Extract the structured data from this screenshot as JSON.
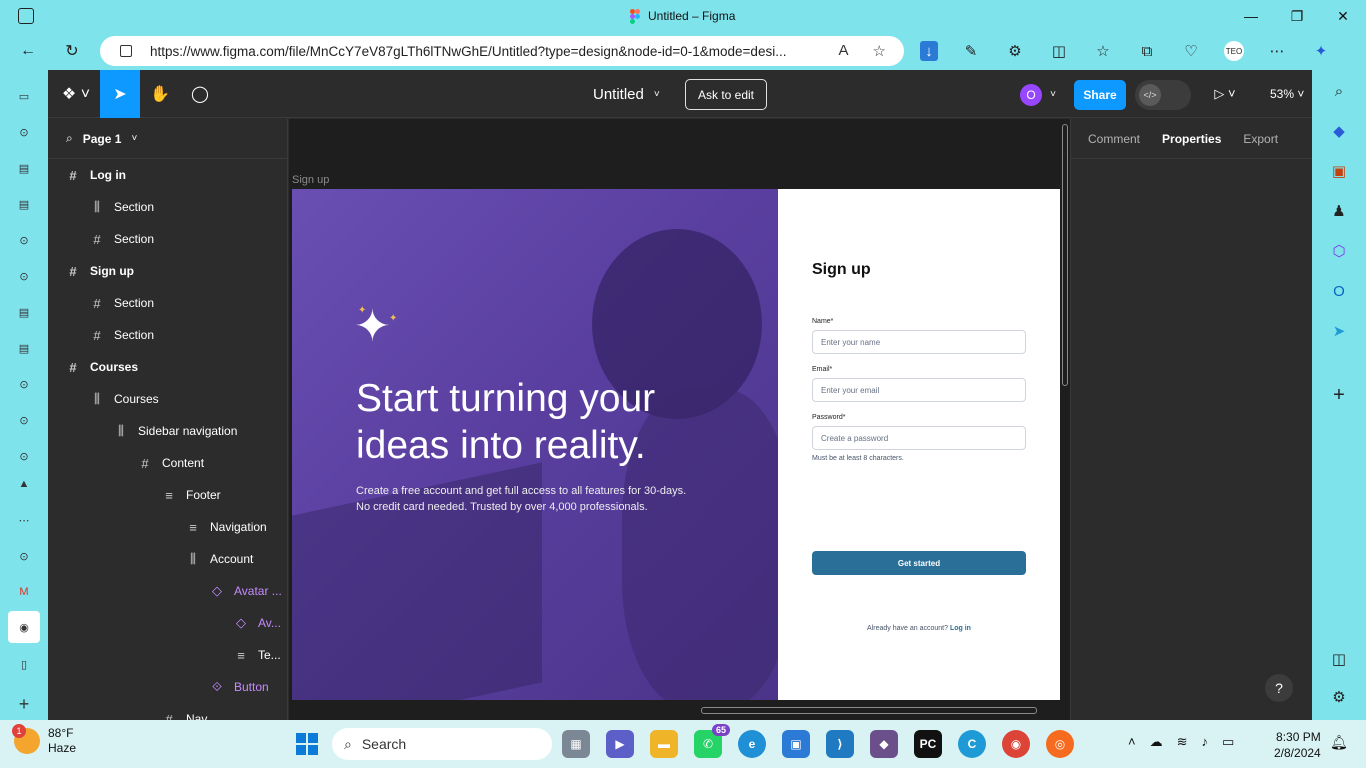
{
  "browser": {
    "window_title": "Untitled – Figma",
    "url": "https://www.figma.com/file/MnCcY7eV87gLTh6lTNwGhE/Untitled?type=design&node-id=0-1&mode=desi...",
    "read_aloud_label": "A",
    "minimize": "—",
    "maximize": "❐",
    "close": "✕"
  },
  "figma": {
    "doc_title": "Untitled",
    "ask_to_edit": "Ask to edit",
    "avatar_initial": "O",
    "share": "Share",
    "zoom": "53%",
    "page_name": "Page 1",
    "layers": [
      {
        "label": "Log in",
        "icon": "frame",
        "indent": 0,
        "bold": true
      },
      {
        "label": "Section",
        "icon": "auto-layout",
        "indent": 1,
        "bold": false
      },
      {
        "label": "Section",
        "icon": "frame",
        "indent": 1,
        "bold": false
      },
      {
        "label": "Sign up",
        "icon": "frame",
        "indent": 0,
        "bold": true
      },
      {
        "label": "Section",
        "icon": "frame",
        "indent": 1,
        "bold": false
      },
      {
        "label": "Section",
        "icon": "frame",
        "indent": 1,
        "bold": false
      },
      {
        "label": "Courses",
        "icon": "frame",
        "indent": 0,
        "bold": true
      },
      {
        "label": "Courses",
        "icon": "auto-layout",
        "indent": 1,
        "bold": false
      },
      {
        "label": "Sidebar navigation",
        "icon": "auto-layout",
        "indent": 2,
        "bold": false
      },
      {
        "label": "Content",
        "icon": "frame",
        "indent": 3,
        "bold": false
      },
      {
        "label": "Footer",
        "icon": "stack",
        "indent": 4,
        "bold": false
      },
      {
        "label": "Navigation",
        "icon": "stack",
        "indent": 5,
        "bold": false
      },
      {
        "label": "Account",
        "icon": "auto-layout",
        "indent": 5,
        "bold": false
      },
      {
        "label": "Avatar ...",
        "icon": "instance",
        "indent": 6,
        "bold": false
      },
      {
        "label": "Av...",
        "icon": "instance",
        "indent": 7,
        "bold": false
      },
      {
        "label": "Te...",
        "icon": "stack",
        "indent": 7,
        "bold": false
      },
      {
        "label": "Button",
        "icon": "component",
        "indent": 6,
        "bold": false
      },
      {
        "label": "Nav",
        "icon": "frame",
        "indent": 4,
        "bold": false
      }
    ],
    "props_tabs": {
      "comment": "Comment",
      "properties": "Properties",
      "export": "Export"
    },
    "help": "?"
  },
  "canvas": {
    "frame_label": "Sign up",
    "hero_title": "Start turning your ideas into reality.",
    "hero_subtitle_1": "Create a free account and get full access to all features for 30-days.",
    "hero_subtitle_2": "No credit card needed. Trusted by over 4,000 professionals.",
    "form": {
      "heading": "Sign up",
      "name_label": "Name*",
      "name_placeholder": "Enter your name",
      "email_label": "Email*",
      "email_placeholder": "Enter your email",
      "password_label": "Password*",
      "password_placeholder": "Create a password",
      "password_hint": "Must be at least 8 characters.",
      "submit": "Get started",
      "footer_text": "Already have an account?",
      "footer_link": "Log in"
    }
  },
  "taskbar": {
    "weather_temp": "88°F",
    "weather_desc": "Haze",
    "weather_badge": "1",
    "search": "Search",
    "whatsapp_count": "65",
    "time": "8:30 PM",
    "date": "2/8/2024"
  },
  "colors": {
    "accent": "#0d99ff",
    "hero_purple": "#5a3fa0",
    "form_button": "#2a6f97",
    "component_purple": "#c58bff"
  }
}
